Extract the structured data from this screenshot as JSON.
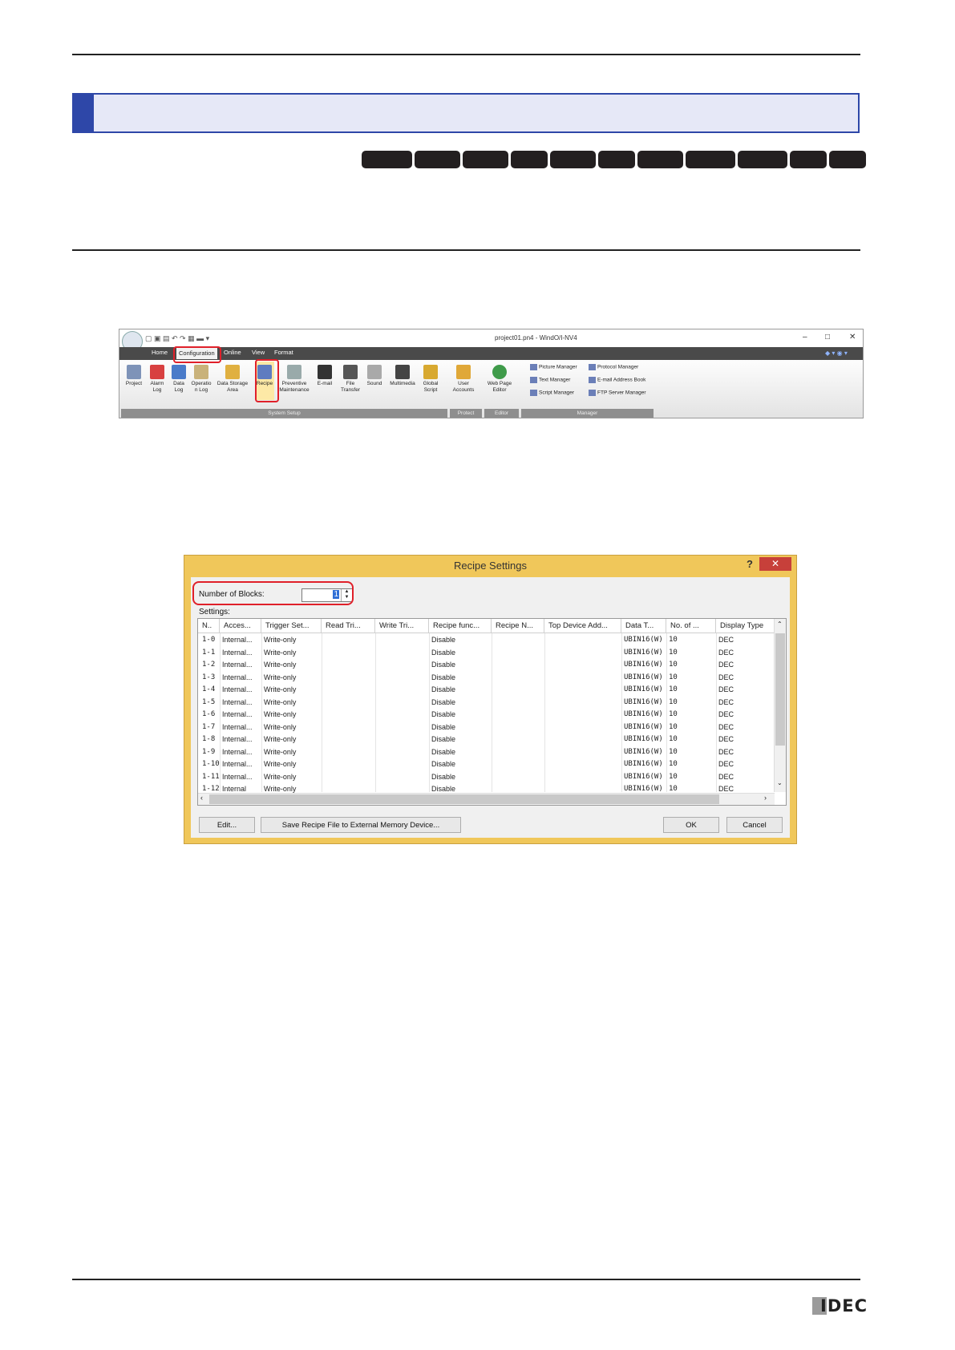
{
  "colors": {
    "section_bar_accent": "#2e47a8",
    "section_bar_fill": "#e6e8f7",
    "highlight": "#e0202a",
    "dialog_frame": "#f0c75a"
  },
  "ribbon": {
    "window_title": "project01.pn4 - WindO/I-NV4",
    "window_controls": [
      "–",
      "□",
      "✕"
    ],
    "tabs": [
      "Home",
      "Configuration",
      "Online",
      "View",
      "Format"
    ],
    "system_setup_buttons": [
      {
        "label": "Project",
        "icon": "project-icon"
      },
      {
        "label": "Alarm\nLog",
        "icon": "alarm-log-icon"
      },
      {
        "label": "Data\nLog",
        "icon": "data-log-icon"
      },
      {
        "label": "Operatio\nn Log",
        "icon": "operation-log-icon"
      },
      {
        "label": "Data Storage\nArea",
        "icon": "data-storage-icon"
      },
      {
        "label": "Recipe",
        "icon": "recipe-icon"
      },
      {
        "label": "Preventive\nMaintenance",
        "icon": "maintenance-icon"
      },
      {
        "label": "E-mail",
        "icon": "email-icon"
      },
      {
        "label": "File\nTransfer",
        "icon": "file-transfer-icon"
      },
      {
        "label": "Sound",
        "icon": "sound-icon"
      },
      {
        "label": "Multimedia",
        "icon": "multimedia-icon"
      },
      {
        "label": "Global\nScript",
        "icon": "script-icon"
      }
    ],
    "protect_button": {
      "label": "User\nAccounts",
      "icon": "user-accounts-icon"
    },
    "editor_button": {
      "label": "Web Page\nEditor",
      "icon": "web-page-icon"
    },
    "manager_items": [
      "Picture Manager",
      "Protocol Manager",
      "Text Manager",
      "E-mail Address Book",
      "Script Manager",
      "FTP Server Manager"
    ],
    "groups": [
      "System Setup",
      "Protect",
      "Editor",
      "Manager"
    ]
  },
  "dialog": {
    "title": "Recipe Settings",
    "help": "?",
    "close": "✕",
    "blocks_label": "Number of Blocks:",
    "blocks_value": "1",
    "settings_label": "Settings:",
    "columns": [
      "N..",
      "Acces...",
      "Trigger Set...",
      "Read Tri...",
      "Write Tri...",
      "Recipe func...",
      "Recipe N...",
      "Top Device Add...",
      "Data T...",
      "No. of ...",
      "Display Type"
    ],
    "rows": [
      [
        "1-0",
        "Internal...",
        "Write-only",
        "",
        "",
        "Disable",
        "",
        "",
        "UBIN16(W)",
        "10",
        "DEC"
      ],
      [
        "1-1",
        "Internal...",
        "Write-only",
        "",
        "",
        "Disable",
        "",
        "",
        "UBIN16(W)",
        "10",
        "DEC"
      ],
      [
        "1-2",
        "Internal...",
        "Write-only",
        "",
        "",
        "Disable",
        "",
        "",
        "UBIN16(W)",
        "10",
        "DEC"
      ],
      [
        "1-3",
        "Internal...",
        "Write-only",
        "",
        "",
        "Disable",
        "",
        "",
        "UBIN16(W)",
        "10",
        "DEC"
      ],
      [
        "1-4",
        "Internal...",
        "Write-only",
        "",
        "",
        "Disable",
        "",
        "",
        "UBIN16(W)",
        "10",
        "DEC"
      ],
      [
        "1-5",
        "Internal...",
        "Write-only",
        "",
        "",
        "Disable",
        "",
        "",
        "UBIN16(W)",
        "10",
        "DEC"
      ],
      [
        "1-6",
        "Internal...",
        "Write-only",
        "",
        "",
        "Disable",
        "",
        "",
        "UBIN16(W)",
        "10",
        "DEC"
      ],
      [
        "1-7",
        "Internal...",
        "Write-only",
        "",
        "",
        "Disable",
        "",
        "",
        "UBIN16(W)",
        "10",
        "DEC"
      ],
      [
        "1-8",
        "Internal...",
        "Write-only",
        "",
        "",
        "Disable",
        "",
        "",
        "UBIN16(W)",
        "10",
        "DEC"
      ],
      [
        "1-9",
        "Internal...",
        "Write-only",
        "",
        "",
        "Disable",
        "",
        "",
        "UBIN16(W)",
        "10",
        "DEC"
      ],
      [
        "1-10",
        "Internal...",
        "Write-only",
        "",
        "",
        "Disable",
        "",
        "",
        "UBIN16(W)",
        "10",
        "DEC"
      ],
      [
        "1-11",
        "Internal...",
        "Write-only",
        "",
        "",
        "Disable",
        "",
        "",
        "UBIN16(W)",
        "10",
        "DEC"
      ],
      [
        "1-12",
        "Internal",
        "Write-only",
        "",
        "",
        "Disable",
        "",
        "",
        "UBIN16(W)",
        "10",
        "DEC"
      ]
    ],
    "buttons": {
      "edit": "Edit...",
      "save": "Save Recipe File to External Memory Device...",
      "ok": "OK",
      "cancel": "Cancel"
    }
  },
  "footer": {
    "logo": "IDEC"
  }
}
